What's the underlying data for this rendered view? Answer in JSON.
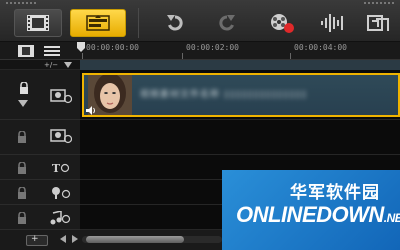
{
  "toolbar": {
    "buttons": [
      {
        "name": "storyboard-view-button",
        "icon": "film-strip-icon"
      },
      {
        "name": "timeline-view-button",
        "icon": "timeline-icon",
        "active": true
      },
      {
        "name": "undo-button",
        "icon": "undo-icon"
      },
      {
        "name": "redo-button",
        "icon": "redo-icon"
      },
      {
        "name": "record-capture-button",
        "icon": "record-icon"
      },
      {
        "name": "sound-mixer-button",
        "icon": "sound-wave-icon"
      },
      {
        "name": "auto-music-button",
        "icon": "auto-music-icon"
      }
    ]
  },
  "ruler": {
    "time_marks": [
      "00:00:00:00",
      "00:00:02:00",
      "00:00:04:00"
    ]
  },
  "zoom": {
    "label": "+/−"
  },
  "tracks": [
    {
      "type": "video",
      "icon": "video-track-icon"
    },
    {
      "type": "overlay",
      "icon": "overlay-track-icon"
    },
    {
      "type": "title",
      "icon": "title-track-icon",
      "label": "T"
    },
    {
      "type": "voice",
      "icon": "voice-track-icon"
    },
    {
      "type": "music",
      "icon": "music-track-icon"
    }
  ],
  "clip": {
    "name": "视频素材文件名称 ▯▯▯▯▯▯▯▯▯▯▯▯▯▯"
  },
  "bottom": {
    "add_label": "+"
  },
  "watermark": {
    "cn": "华军软件园",
    "en": "ONLINEDOWN",
    "net": ".NET"
  },
  "colors": {
    "accent": "#f0b400",
    "clip_bg": "#2f4a58",
    "watermark_bg": "#1f7ac9"
  }
}
